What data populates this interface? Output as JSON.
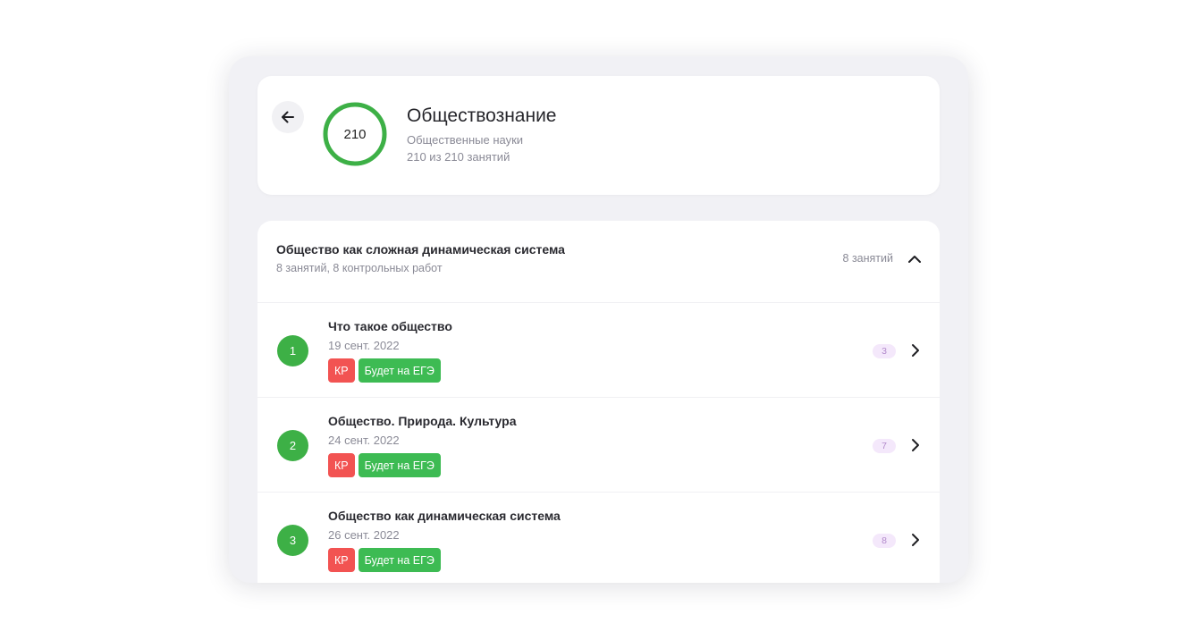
{
  "header": {
    "back_icon": "arrow-left-icon",
    "progress_value": "210",
    "progress_fraction": 1.0,
    "progress_color": "#3db046",
    "title": "Обществознание",
    "subtitle": "Общественные науки",
    "lessons_count": "210 из 210 занятий"
  },
  "section": {
    "title": "Общество как сложная динамическая система",
    "subtitle": "8 занятий, 8 контрольных работ",
    "count": "8 занятий",
    "toggle_icon": "chevron-up-icon"
  },
  "lessons": [
    {
      "number": "1",
      "title": "Что такое общество",
      "date": "19 сент. 2022",
      "tag_kr": "КР",
      "tag_ege": "Будет на ЕГЭ",
      "badge": "3"
    },
    {
      "number": "2",
      "title": "Общество. Природа. Культура",
      "date": "24 сент. 2022",
      "tag_kr": "КР",
      "tag_ege": "Будет на ЕГЭ",
      "badge": "7"
    },
    {
      "number": "3",
      "title": "Общество как динамическая система",
      "date": "26 сент. 2022",
      "tag_kr": "КР",
      "tag_ege": "Будет на ЕГЭ",
      "badge": "8"
    }
  ],
  "colors": {
    "accent_green": "#3db046",
    "tag_red": "#f25352",
    "tag_green": "#3dbb53",
    "badge_bg": "#f4e8fb"
  }
}
